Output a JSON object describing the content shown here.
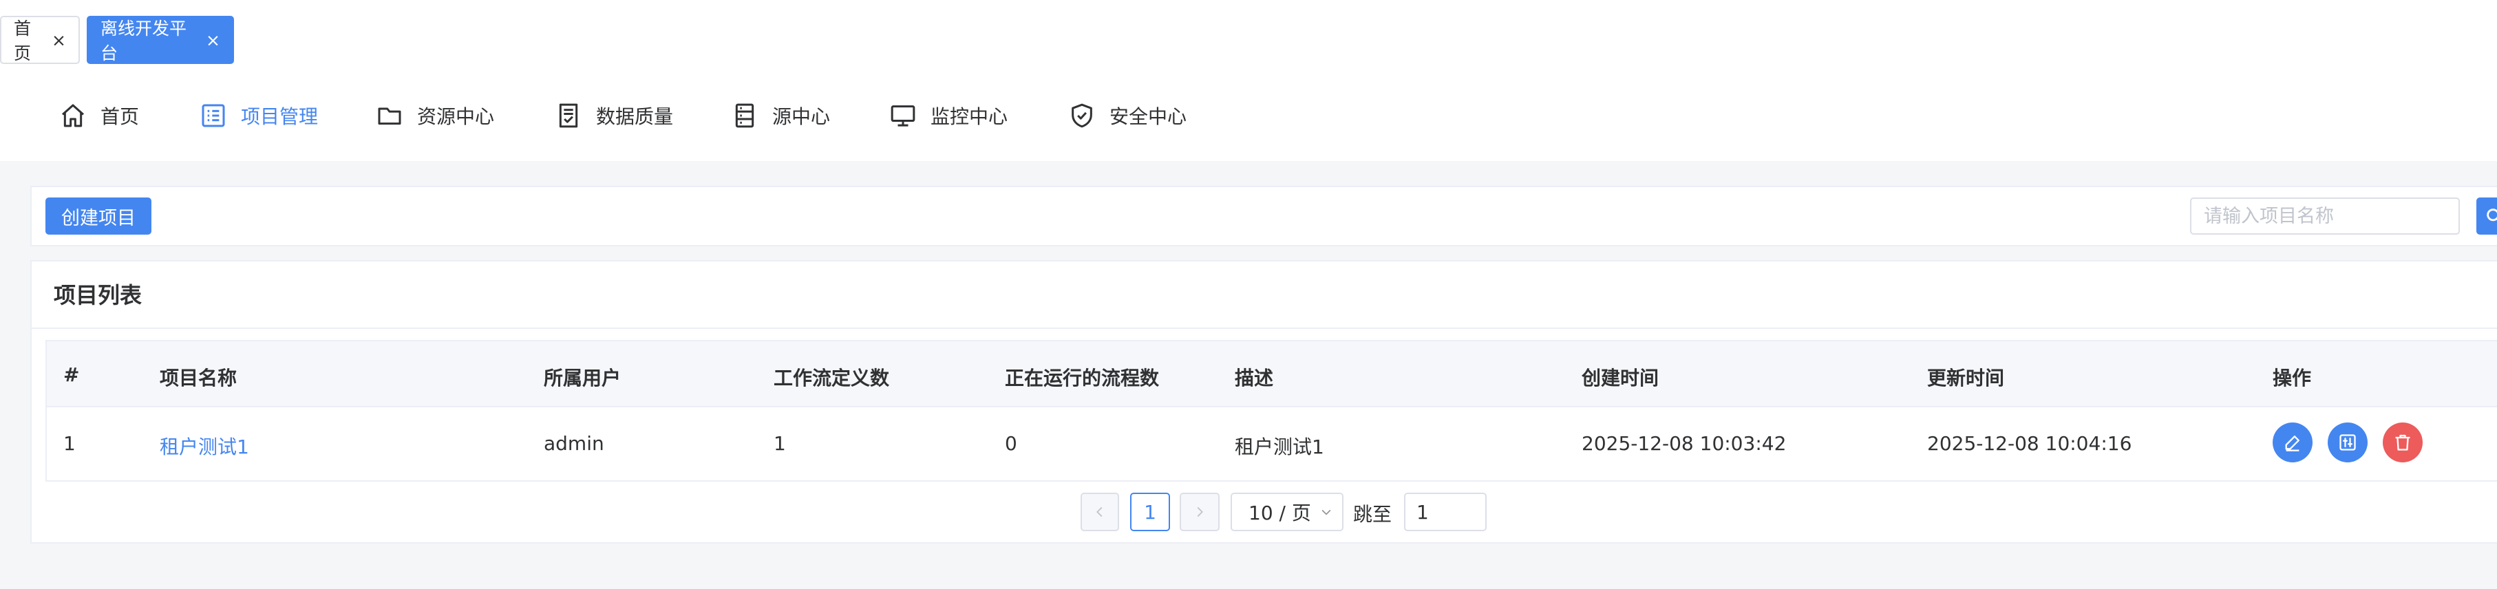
{
  "tabs": [
    {
      "label": "首页",
      "close": "×"
    },
    {
      "label": "离线开发平台",
      "close": "×"
    }
  ],
  "nav": {
    "items": [
      {
        "label": "首页",
        "icon": "home-icon"
      },
      {
        "label": "项目管理",
        "icon": "list-icon"
      },
      {
        "label": "资源中心",
        "icon": "folder-icon"
      },
      {
        "label": "数据质量",
        "icon": "document-check-icon"
      },
      {
        "label": "源中心",
        "icon": "database-icon"
      },
      {
        "label": "监控中心",
        "icon": "monitor-icon"
      },
      {
        "label": "安全中心",
        "icon": "shield-icon"
      }
    ],
    "active": "项目管理"
  },
  "toolbar": {
    "create_label": "创建项目",
    "search_placeholder": "请输入项目名称"
  },
  "panel": {
    "title": "项目列表"
  },
  "table": {
    "columns": [
      "#",
      "项目名称",
      "所属用户",
      "工作流定义数",
      "正在运行的流程数",
      "描述",
      "创建时间",
      "更新时间",
      "操作"
    ],
    "rows": [
      {
        "index": "1",
        "name": "租户测试1",
        "user": "admin",
        "workflow_count": "1",
        "running_count": "0",
        "description": "租户测试1",
        "created": "2025-12-08 10:03:42",
        "updated": "2025-12-08 10:04:16",
        "actions": [
          "edit-icon",
          "settings-icon",
          "delete-icon"
        ]
      }
    ]
  },
  "pagination": {
    "current_page": "1",
    "page_size": "10 / 页",
    "jump_label": "跳至",
    "jump_value": "1"
  },
  "colors": {
    "primary": "#4486f0",
    "danger": "#ed5b5b",
    "text": "#303133",
    "background": "#f5f6f8"
  }
}
